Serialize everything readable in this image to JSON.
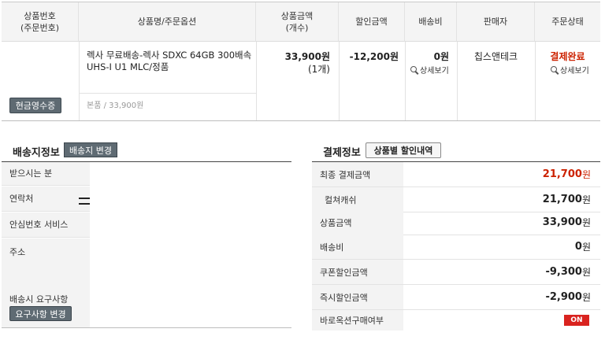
{
  "order": {
    "headers": {
      "product_no": "상품번호\n(주문번호)",
      "product_name": "상품명/주문옵션",
      "amount": "상품금액\n(개수)",
      "discount": "할인금액",
      "shipping": "배송비",
      "seller": "판매자",
      "status": "주문상태"
    },
    "cash_receipt_button": "현금영수증",
    "product_title": "렉사 무료배송-렉사 SDXC 64GB 300배속 UHS-I U1 MLC/정품",
    "option_line": "본품 / 33,900원",
    "amount_value": "33,900원",
    "amount_count": "(1개)",
    "discount_value": "-12,200원",
    "shipping_value": "0원",
    "shipping_detail_link": "상세보기",
    "seller_name": "칩스앤테크",
    "status_value": "결제완료",
    "status_detail_link": "상세보기",
    "status_color": "#cc2200"
  },
  "shipping_info": {
    "title": "배송지정보",
    "change_button": "배송지 변경",
    "labels": {
      "recipient": "받으시는 분",
      "contact": "연락처",
      "safe_number": "안심번호 서비스",
      "address": "주소",
      "request": "배송시 요구사항"
    },
    "request_change_button": "요구사항 변경"
  },
  "payment_info": {
    "title": "결제정보",
    "discount_detail_button": "상품별 할인내역",
    "rows": [
      {
        "label": "최종 결제금액",
        "value": "21,700",
        "unit": "원",
        "highlight": true
      },
      {
        "label": "컬쳐캐쉬",
        "value": "21,700",
        "unit": "원"
      },
      {
        "label": "상품금액",
        "value": "33,900",
        "unit": "원"
      },
      {
        "label": "배송비",
        "value": "0",
        "unit": "원"
      },
      {
        "label": "쿠폰할인금액",
        "value": "-9,300",
        "unit": "원"
      },
      {
        "label": "즉시할인금액",
        "value": "-2,900",
        "unit": "원"
      }
    ],
    "baro_label": "바로옥션구매여부",
    "baro_badge": "ON",
    "badge_color": "#d9231f",
    "highlight_color": "#cc2200"
  }
}
